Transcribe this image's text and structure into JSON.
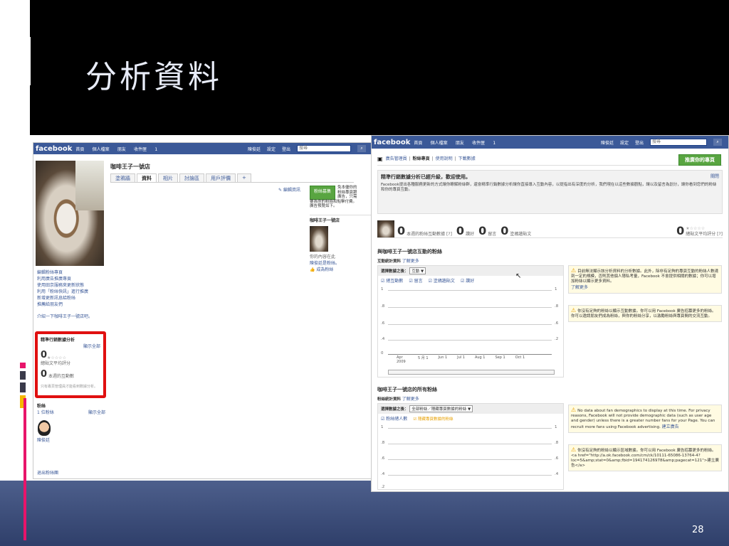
{
  "slide": {
    "title": "分析資料",
    "page_number": "28",
    "colors": {
      "title": "#e8ecf8",
      "accent_pink": "#e8146a",
      "bar_dark": "#3a3a4a",
      "bar_yellow": "#f5b800"
    }
  },
  "left_shot": {
    "fb_logo": "facebook",
    "nav": [
      "首頁",
      "個人檔案",
      "朋友",
      "收件匣",
      "1"
    ],
    "right_nav": [
      "陳俊廷",
      "設定",
      "登出"
    ],
    "search_placeholder": "搜尋",
    "profile_name": "咖啡王子一號店",
    "tabs": [
      "塗鴉牆",
      "資料",
      "相片",
      "討論區",
      "用戶評價",
      "+"
    ],
    "edit_link": "編輯資訊",
    "left_links": [
      "編輯粉絲專頁",
      "利用廣告推廣專頁",
      "使用田京服務來更新狀態",
      "利用「粉絲快訊」進行推廣",
      "新增更新訊息給粉絲",
      "推薦給朋友們"
    ],
    "intro": "介紹一下咖啡王子一號店吧。",
    "ads_button": "粉絲募集",
    "ads_text": [
      "免本優你的",
      "粉絲專頁跟",
      "廣告，只需",
      "要為你的粉絲和點擊付費。",
      "廣告預覽如下。"
    ],
    "ad_preview_title": "咖啡王子一號店",
    "ad_preview_text": [
      "你的內容在此",
      "陳俊廷是粉絲。",
      "成為粉絲"
    ],
    "insights": {
      "title": "精準行銷數據分析",
      "see_all": "顯示全部",
      "rating_label": "總貼文平均評分",
      "count_value": "0",
      "count_label": "本週的互動數",
      "footer": "只有專頁管理員才能看到數據分析。"
    },
    "fans": {
      "title": "粉絲",
      "count": "1 位粉絲",
      "see_all": "顯示全部",
      "fan_name": "陳俊廷"
    },
    "footer_link": "退出粉絲團"
  },
  "right_shot": {
    "fb_logo": "facebook",
    "nav": [
      "首頁",
      "個人檔案",
      "朋友",
      "收件匣",
      "1"
    ],
    "right_nav": [
      "陳俊廷",
      "設定",
      "登出"
    ],
    "search_placeholder": "搜尋",
    "toolbar": [
      "廣告管理員",
      "粉絲專頁",
      "使用說明",
      "下載數據"
    ],
    "promote_button": "推廣你的專頁",
    "notice_title": "精準行銷數據分析已經升級，歡迎使用。",
    "notice_text": "Facebook提出各種服務更新的方式讓你瞭解粉絲群，還會精準行銷數據分析讓你直接導入互動內容，以提指出有深度的分析，我們現在以這些數據觀點，讓以及留言為創分，讓你看到您們的粉絲和你的專頁互動。",
    "notice_link": "關閉",
    "stats": [
      {
        "value": "0",
        "label": "本週的粉絲互動數據 [?]"
      },
      {
        "value": "0",
        "label": "讚好"
      },
      {
        "value": "0",
        "label": "留言"
      },
      {
        "value": "0",
        "label": "塗鴉牆貼文"
      }
    ],
    "rating": {
      "value": "0",
      "label": "總貼文平均評分 [?]"
    },
    "section1": {
      "title": "與咖啡王子一號店互動的粉絲",
      "sub": "互動統計資料",
      "sub_link": "了解更多",
      "select_label": "選擇數據之後：",
      "select_value": "互動",
      "legends": [
        "總互動數",
        "留言",
        "塗鴉牆貼文",
        "讚好"
      ],
      "y_ticks": [
        "1",
        ".8",
        ".6",
        ".4",
        ".2",
        "0"
      ],
      "x_ticks": [
        "Apr 2009",
        "5 月 1",
        "Jun 1",
        "Jul 1",
        "Aug 1",
        "Sep 1",
        "Oct 1"
      ]
    },
    "warn1": "目前無法顯示該分析資料的分析數據。此外，除非有足夠的專頁互動的粉絲人數達到一定的規模，否則其他個人隱私考量，Facebook 不會提供相關的數據；你可以增加粉絲以顯示更多資料。",
    "warn1_link": "了解更多",
    "warn2": "你沒有足夠的粉絲以顯示互動數據。你可以用 Facebook 廣告招募更多的粉絲。你可以邀請朋友們成為粉絲，與你的粉絲分享，以激勵粉絲與專頁間的交流互動。",
    "section2": {
      "title": "咖啡王子一號店的所有粉絲",
      "sub": "粉絲統計資料",
      "sub_link": "了解更多",
      "select_label": "選擇數據之後：",
      "select_value": "全部粉絲／隱藏專頁數據的粉絲",
      "legends": [
        "粉絲總人數",
        "隱藏專頁數據的粉絲"
      ],
      "y_ticks": [
        "1",
        ".8",
        ".6",
        ".4",
        ".2"
      ]
    },
    "warn3": "No data about fan demographics to display at this time. For privacy reasons, Facebook will not provide demographic data (such as user age and gender) unless there is a greater number fans for your Page. You can recruit more fans using Facebook advertising.",
    "warn3_link": "建立廣告",
    "warn4": "你沒有足夠的粉絲以顯示區域數據。你可以用 Facebook 廣告招募更多的粉絲。<a href=\"http://a.ok.facebook.com/cm/ck/10111-65086-13764-4?loc=5&amp;stat=0&amp;fbid=194174126978&amp;pagecat=121\">建立廣告</a>"
  }
}
